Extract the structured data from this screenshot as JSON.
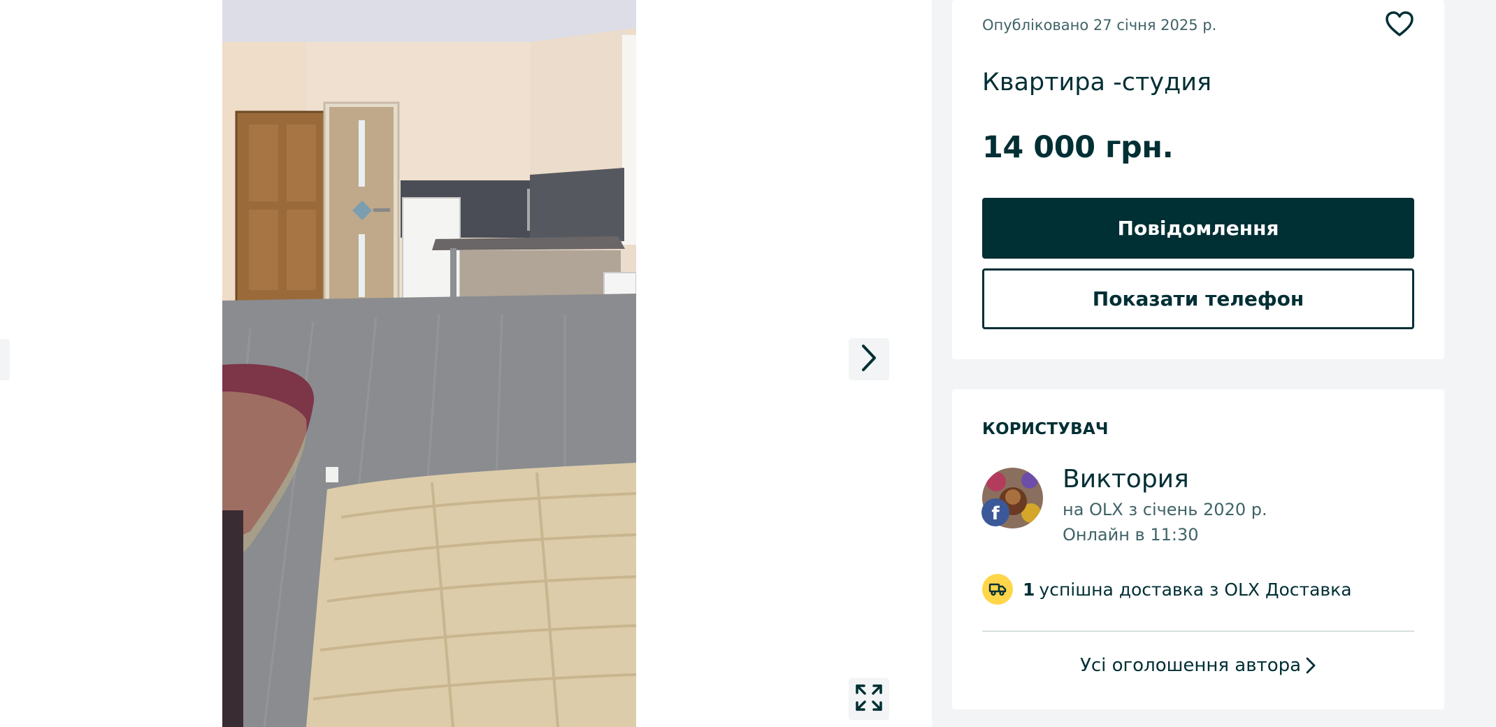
{
  "gallery": {
    "prev_icon": "chevron-left-icon",
    "next_icon": "chevron-right-icon",
    "expand_icon": "expand-fullscreen-icon"
  },
  "offer": {
    "posted": "Опубліковано 27 січня 2025 р.",
    "favorite_icon": "heart-outline-icon",
    "title": "Квартира -студия",
    "price": "14 000 грн.",
    "message_button": "Повідомлення",
    "phone_button": "Показати телефон"
  },
  "user": {
    "heading": "КОРИСТУВАЧ",
    "name": "Виктория",
    "since": "на OLX з січень 2020 р.",
    "online": "Онлайн в 11:30",
    "badge_icon": "facebook-icon",
    "delivery_icon": "delivery-truck-icon",
    "delivery_count": "1",
    "delivery_text": "успішна доставка з OLX Доставка",
    "all_ads": "Усі оголошення автора"
  },
  "colors": {
    "primary": "#002f34",
    "background": "#f2f4f5",
    "delivery_badge": "#ffd64a",
    "facebook": "#3b5998"
  }
}
